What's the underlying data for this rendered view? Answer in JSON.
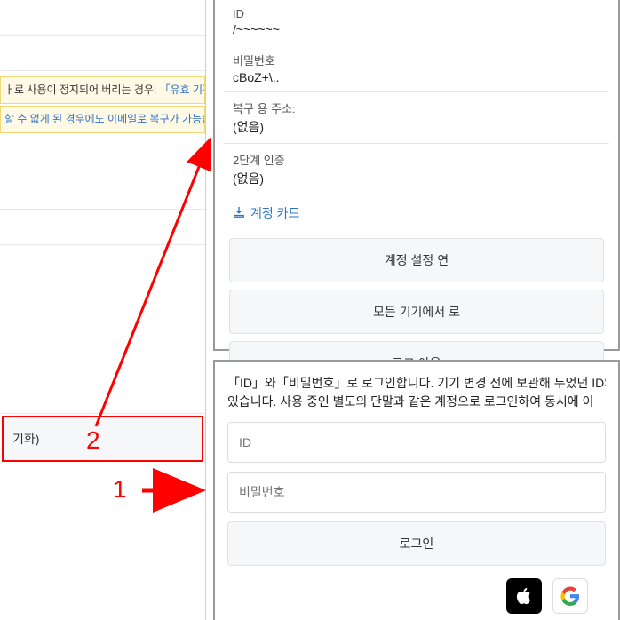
{
  "left": {
    "notice1_prefix": "ㅏ로 사용이 정지되어 버리는 경우: ",
    "notice1_link": "「유효 기간이있는",
    "notice2_prefix": "할 수 없게 된 경우에도 이메일로 복구가 가능합니",
    "reset_label": "기화)"
  },
  "account": {
    "id_label": "ID",
    "id_value": "/~~~~~~",
    "pw_label": "비밀번호",
    "pw_value": "cBoZ+\\..",
    "recovery_label": "복구 용 주소:",
    "recovery_value": "(없음)",
    "twofa_label": "2단계 인증",
    "twofa_value": "(없음)",
    "download_card": "계정 카드",
    "btn_settings": "계정 설정 연",
    "btn_logout_all": "모든 기기에서 로",
    "btn_logout": "로그 아웃"
  },
  "login": {
    "desc1": "「ID」와「비밀번호」로 로그인합니다. 기기 변경 전에 보관해 두었던 ID와",
    "desc2": "있습니다. 사용 중인 별도의 단말과 같은 계정으로 로그인하여 동시에 이",
    "id_placeholder": "ID",
    "pw_placeholder": "비밀번호",
    "login_btn": "로그인"
  },
  "annotations": {
    "n1": "1",
    "n2": "2"
  }
}
